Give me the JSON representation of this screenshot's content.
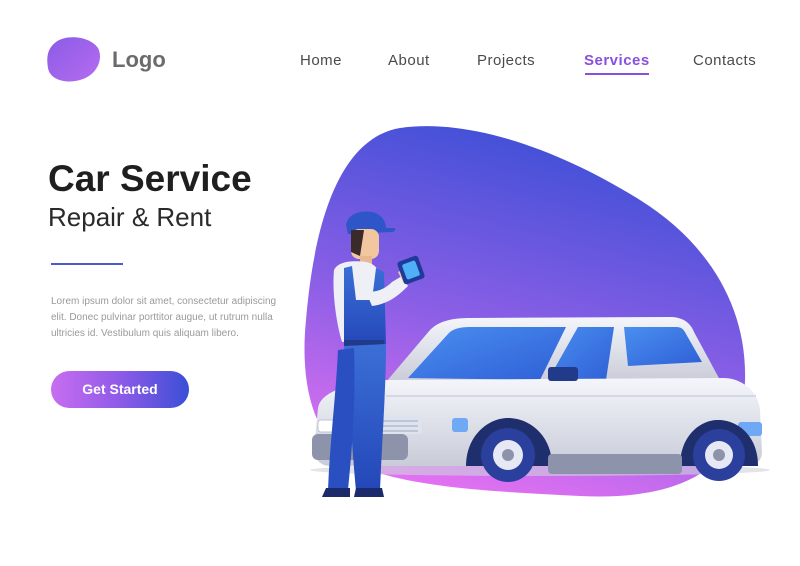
{
  "brand": {
    "logo_text": "Logo"
  },
  "nav": {
    "items": [
      {
        "label": "Home"
      },
      {
        "label": "About"
      },
      {
        "label": "Projects"
      },
      {
        "label": "Services",
        "active": true
      },
      {
        "label": "Contacts"
      }
    ]
  },
  "hero": {
    "title": "Car Service",
    "subtitle": "Repair & Rent",
    "body": "Lorem ipsum dolor sit amet, consectetur adipiscing elit. Donec pulvinar porttitor augue, ut rutrum nulla ultricies id. Vestibulum quis aliquam libero.",
    "cta_label": "Get Started"
  },
  "colors": {
    "accent": "#8a4fe0",
    "blob_top": "#3b4fd6",
    "blob_bottom": "#e070f0",
    "text_dark": "#1f1f1f"
  },
  "illustration": {
    "subject": "mechanic-with-phone",
    "object": "white-sedan-car"
  }
}
